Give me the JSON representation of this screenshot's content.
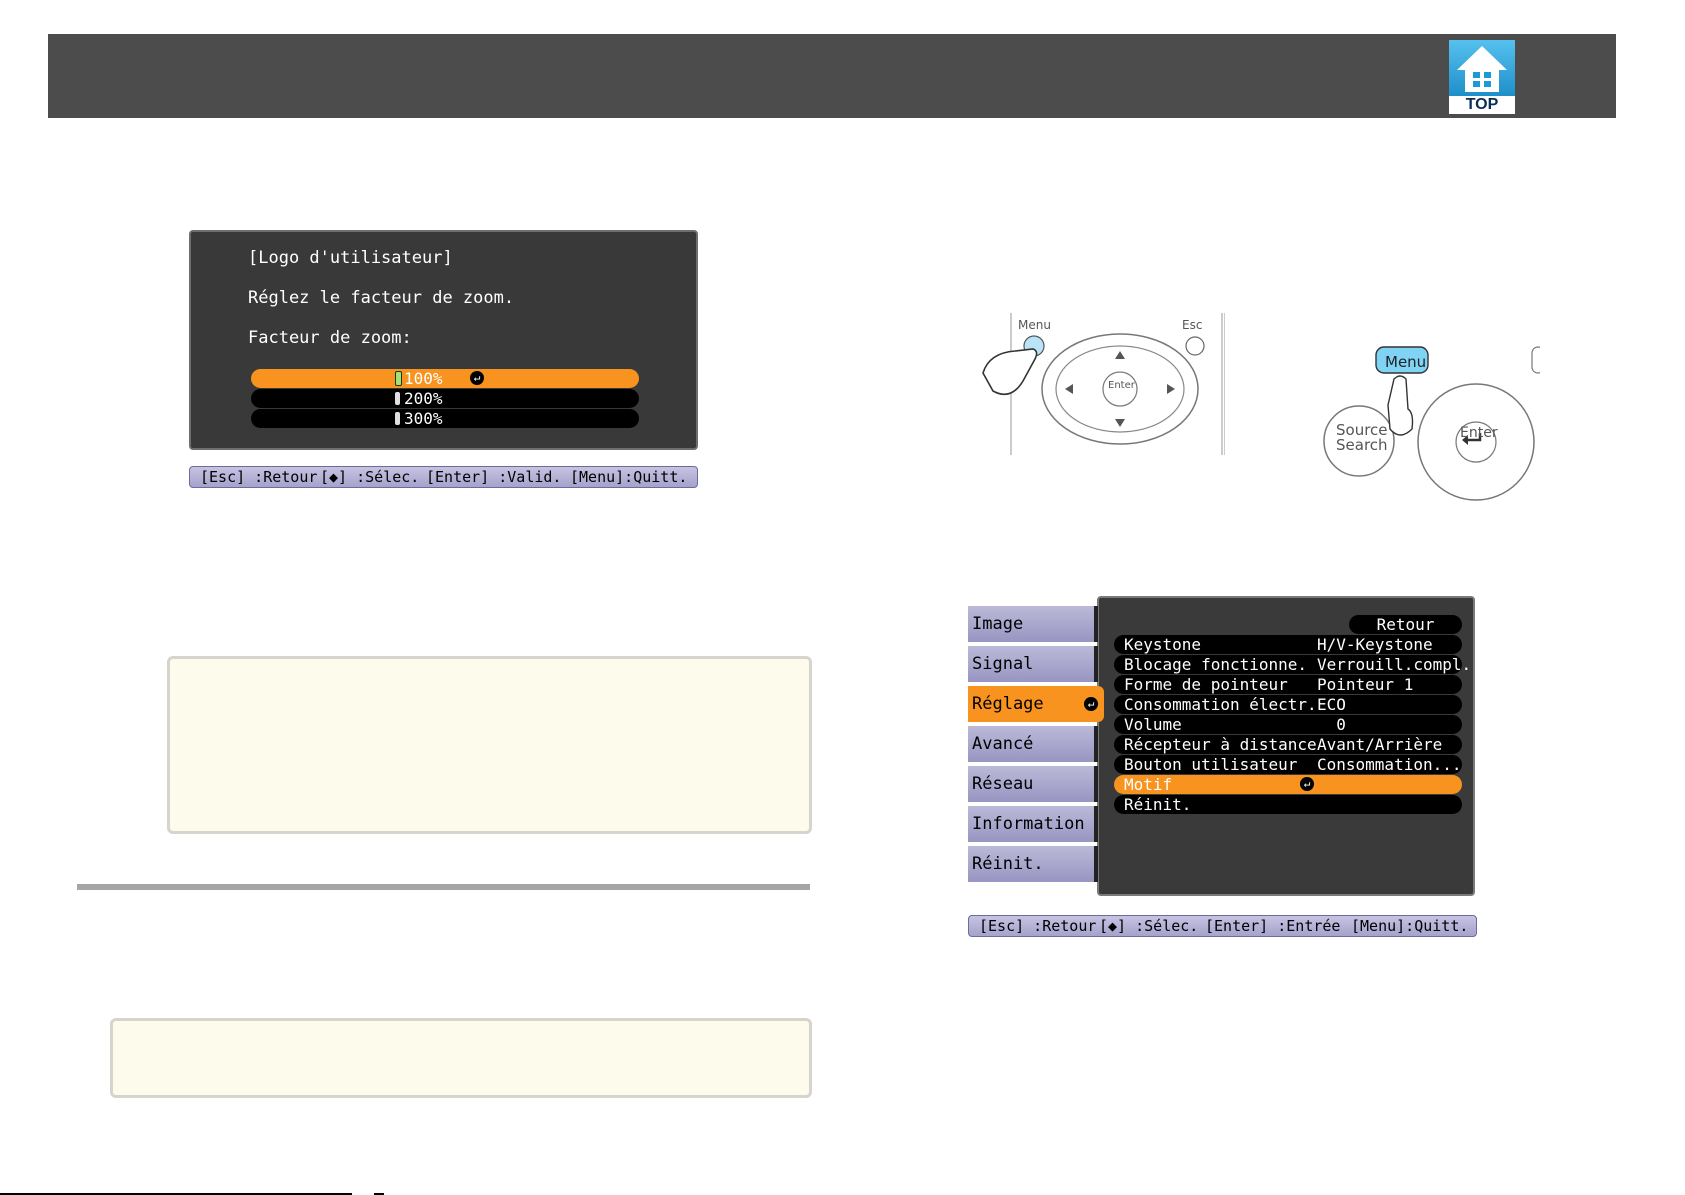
{
  "zoom_dialog": {
    "title": "[Logo d'utilisateur]",
    "instruction": "Réglez le facteur de zoom.",
    "field_label": "Facteur de zoom:",
    "options": [
      {
        "label": "100%",
        "selected": true
      },
      {
        "label": "200%",
        "selected": false
      },
      {
        "label": "300%",
        "selected": false
      }
    ],
    "help": {
      "esc": "[Esc] :Retour",
      "select": "[◆] :Sélec.",
      "enter": "[Enter] :Valid.",
      "menu": "[Menu]:Quitt."
    }
  },
  "top_button": {
    "label": "TOP"
  },
  "remote_left": {
    "menu": "Menu",
    "esc": "Esc",
    "enter": "Enter"
  },
  "remote_right": {
    "menu": "Menu",
    "source": "Source",
    "search": "Search",
    "enter": "Enter"
  },
  "settings_menu": {
    "tabs": [
      {
        "label": "Image",
        "selected": false
      },
      {
        "label": "Signal",
        "selected": false
      },
      {
        "label": "Réglage",
        "selected": true
      },
      {
        "label": "Avancé",
        "selected": false
      },
      {
        "label": "Réseau",
        "selected": false
      },
      {
        "label": "Information",
        "selected": false
      },
      {
        "label": "Réinit.",
        "selected": false
      }
    ],
    "back_label": "Retour",
    "rows": [
      {
        "label": "Keystone",
        "value": "H/V-Keystone",
        "selected": false
      },
      {
        "label": "Blocage fonctionne.",
        "value": "Verrouill.compl.",
        "selected": false
      },
      {
        "label": "Forme de pointeur",
        "value": "Pointeur 1",
        "selected": false
      },
      {
        "label": "Consommation électr.",
        "value": "ECO",
        "selected": false
      },
      {
        "label": "Volume",
        "value": "  0",
        "selected": false
      },
      {
        "label": "Récepteur à distance",
        "value": "Avant/Arrière",
        "selected": false
      },
      {
        "label": "Bouton utilisateur",
        "value": "Consommation...",
        "selected": false
      },
      {
        "label": "Motif",
        "value": "",
        "selected": true
      },
      {
        "label": "Réinit.",
        "value": "",
        "selected": false
      }
    ],
    "help": {
      "esc": "[Esc] :Retour",
      "select": "[◆] :Sélec.",
      "enter": "[Enter] :Entrée",
      "menu": "[Menu]:Quitt."
    }
  },
  "colors": {
    "header": "#4c4c4c",
    "accent": "#f7931e",
    "note_bg": "#fdfbec",
    "tab": "#a9a7cc"
  }
}
